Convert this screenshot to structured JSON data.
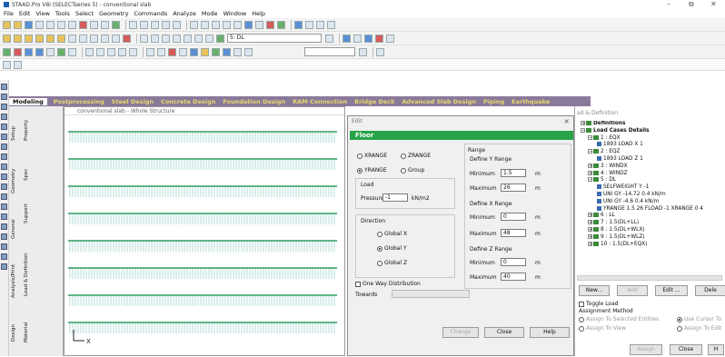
{
  "window": {
    "title": "STAAD.Pro V8i (SELECTseries 5) - conventional slab",
    "minimize": "–",
    "restore": "⧉",
    "close": "✕"
  },
  "menu": [
    "File",
    "Edit",
    "View",
    "Tools",
    "Select",
    "Geometry",
    "Commands",
    "Analyze",
    "Mode",
    "Window",
    "Help"
  ],
  "toolbar": {
    "load_case_combo": "5: DL",
    "page_combo": ""
  },
  "tabs": [
    "Modeling",
    "Postprocessing",
    "Steel Design",
    "Concrete Design",
    "Foundation Design",
    "RAM Connection",
    "Bridge Deck",
    "Advanced Slab Design",
    "Piping",
    "Earthquake"
  ],
  "side_tabs": [
    "Setup",
    "Geometry",
    "General",
    "Analysis/Print",
    "Design",
    "Property",
    "Spec",
    "Support",
    "Load & Definition",
    "Material"
  ],
  "viewport": {
    "title": "conventional slab - Whole Structure",
    "axis_label": "X"
  },
  "dialog": {
    "title": "Edit",
    "tab": "Floor",
    "xrange": "XRANGE",
    "zrange": "ZRANGE",
    "yrange": "YRANGE",
    "group": "Group",
    "load_label": "Load",
    "pressure_label": "Pressure",
    "pressure_value": "-1",
    "pressure_unit": "kN/m2",
    "direction_label": "Direction",
    "global_x": "Global X",
    "global_y": "Global Y",
    "global_z": "Global Z",
    "one_way": "One Way Distribution",
    "towards": "Towards",
    "range_label": "Range",
    "y_range_label": "Define Y Range",
    "x_range_label": "Define X Range",
    "z_range_label": "Define Z Range",
    "minimum": "Minimum",
    "maximum": "Maximum",
    "unit": "m",
    "y_min": "1.5",
    "y_max": "26",
    "x_min": "0",
    "x_max": "48",
    "z_min": "0",
    "z_max": "40",
    "change": "Change",
    "close": "Close",
    "help": "Help"
  },
  "right_panel": {
    "title": "ad & Definition",
    "tree": [
      "Definitions",
      "Load Cases Details",
      "1 : EQX",
      "1893 LOAD X 1",
      "2 : EQZ",
      "1893 LOAD Z 1",
      "3 : WINDX",
      "4 : WINDZ",
      "5 : DL",
      "SELFWEIGHT Y -1",
      "UNI GY -14.72 0.4 kN/m",
      "UNI GY -4.6 0.4 kN/m",
      "YRANGE 1.5 26 FLOAD -1 XRANGE 0 4",
      "6 : LL",
      "7 : 1.5(DL+LL)",
      "8 : 1.5(DL+WLX)",
      "9 : 1.5(DL+WLZ)",
      "10 : 1.5(DL+EQX)"
    ],
    "new_btn": "New...",
    "add_btn": "Add",
    "edit_btn": "Edit ...",
    "delete_btn": "Dele",
    "toggle_load": "Toggle Load",
    "assign_method": "Assignment Method",
    "assign_selected": "Assign To Selected Entities",
    "assign_view": "Assign To View",
    "use_cursor": "Use Cursor To",
    "assign_edit": "Assign To Edit",
    "assign_btn": "Assign",
    "close_btn": "Close",
    "help_btn": "H"
  }
}
